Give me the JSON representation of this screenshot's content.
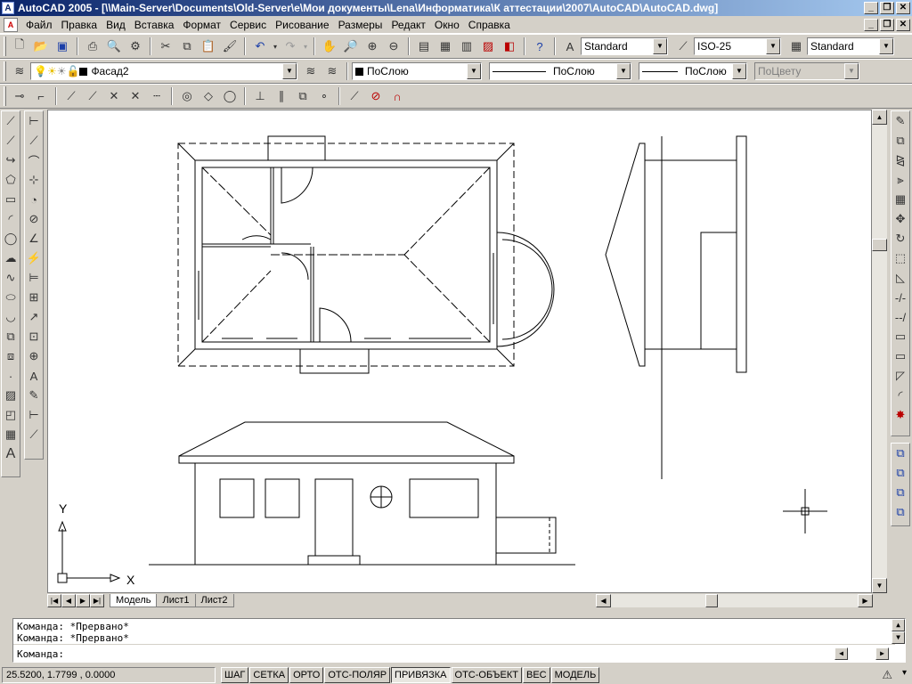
{
  "window": {
    "app_icon": "autocad-icon",
    "title": "AutoCAD 2005 - [\\\\Main-Server\\Documents\\Old-Server\\e\\Мои документы\\Lena\\Информатика\\К аттестации\\2007\\AutoCAD\\AutoCAD.dwg]",
    "controls": [
      "_",
      "❐",
      "✕"
    ]
  },
  "menu": {
    "items": [
      "Файл",
      "Правка",
      "Вид",
      "Вставка",
      "Формат",
      "Сервис",
      "Рисование",
      "Размеры",
      "Редакт",
      "Окно",
      "Справка"
    ]
  },
  "toolbar_standard": {
    "text_style": "Standard",
    "dim_style": "ISO-25",
    "table_style": "Standard"
  },
  "toolbar_layers": {
    "layer_name": "Фасад2",
    "color": "ПоСлою",
    "linetype": "ПоСлою",
    "lineweight": "ПоСлою",
    "plotstyle": "ПоЦвету"
  },
  "drawing": {
    "ucs_y_label": "Y",
    "ucs_x_label": "X"
  },
  "layout_tabs": [
    "Модель",
    "Лист1",
    "Лист2"
  ],
  "layout_nav": [
    "|◀",
    "◀",
    "▶",
    "▶|"
  ],
  "command": {
    "history": [
      "Команда:  *Прервано*",
      "Команда:  *Прервано*"
    ],
    "prompt": "Команда:"
  },
  "status": {
    "coords": "25.5200, 1.7799 , 0.0000",
    "toggles": [
      {
        "label": "ШАГ",
        "on": false
      },
      {
        "label": "СЕТКА",
        "on": false
      },
      {
        "label": "ОРТО",
        "on": false
      },
      {
        "label": "ОТС-ПОЛЯР",
        "on": false
      },
      {
        "label": "ПРИВЯЗКА",
        "on": true
      },
      {
        "label": "ОТС-ОБЪЕКТ",
        "on": false
      },
      {
        "label": "ВЕС",
        "on": false
      },
      {
        "label": "МОДЕЛЬ",
        "on": false
      }
    ]
  },
  "colors": {
    "title_gradient_start": "#0a246a",
    "title_gradient_end": "#a6caf0",
    "canvas": "#ffffff",
    "face": "#d4d0c8"
  }
}
